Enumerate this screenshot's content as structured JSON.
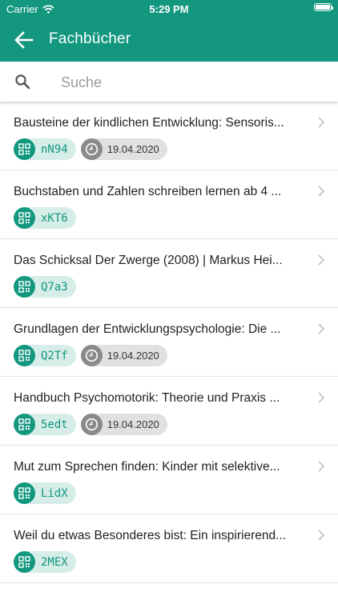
{
  "status_bar": {
    "carrier": "Carrier",
    "time": "5:29 PM"
  },
  "header": {
    "title": "Fachbücher",
    "back_icon": "arrow-left-icon"
  },
  "search": {
    "placeholder": "Suche",
    "value": ""
  },
  "colors": {
    "accent": "#13977f",
    "tag_bg": "#d6ede8",
    "date_bg": "#e1e1e1"
  },
  "books": [
    {
      "title": "Bausteine der kindlichen Entwicklung: Sensoris...",
      "code": "nN94",
      "date": "19.04.2020"
    },
    {
      "title": "Buchstaben und Zahlen schreiben lernen ab 4 ...",
      "code": "xKT6",
      "date": ""
    },
    {
      "title": "Das Schicksal Der Zwerge (2008) | Markus Hei...",
      "code": "Q7a3",
      "date": ""
    },
    {
      "title": "Grundlagen der Entwicklungspsychologie: Die ...",
      "code": "Q2Tf",
      "date": "19.04.2020"
    },
    {
      "title": "Handbuch Psychomotorik: Theorie und Praxis ...",
      "code": "5edt",
      "date": "19.04.2020"
    },
    {
      "title": "Mut zum Sprechen finden: Kinder mit selektive...",
      "code": "LidX",
      "date": ""
    },
    {
      "title": "Weil du etwas Besonderes bist: Ein inspirierend...",
      "code": "2MEX",
      "date": ""
    }
  ]
}
